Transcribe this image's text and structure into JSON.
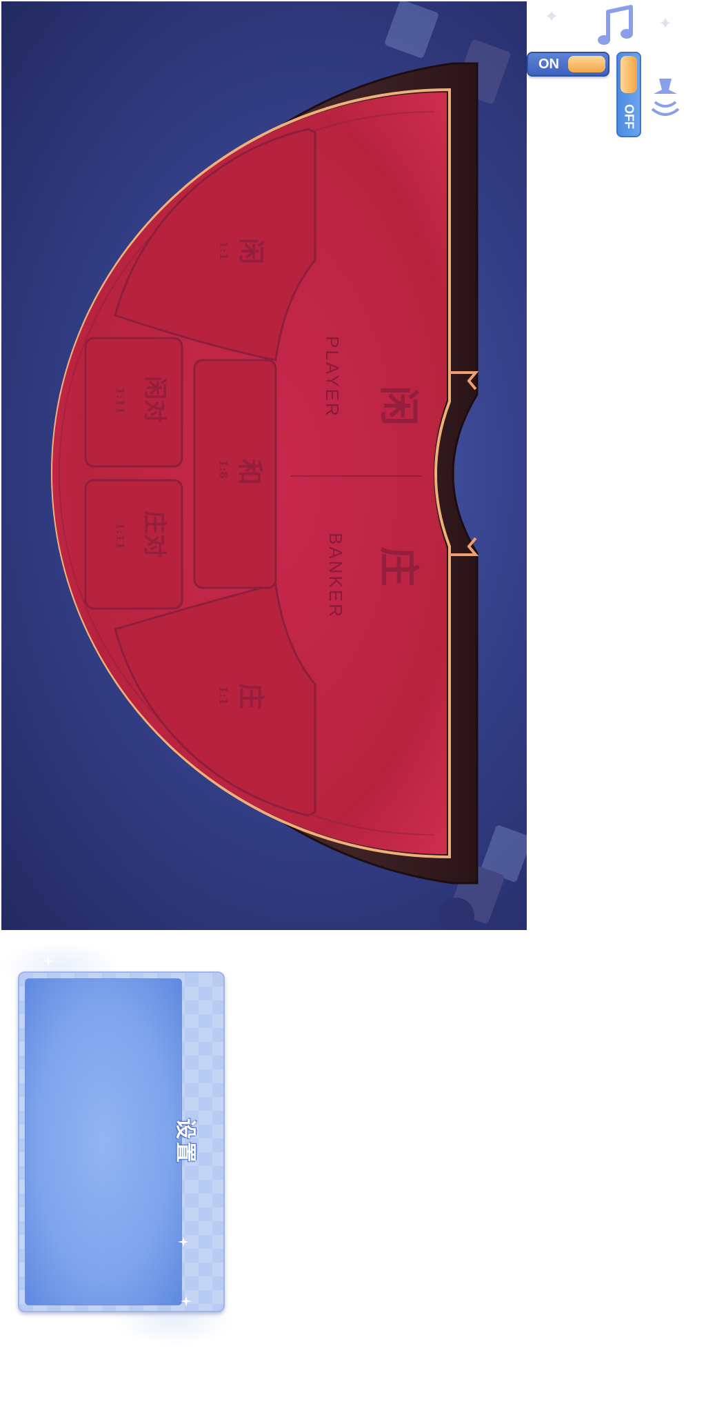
{
  "table": {
    "player_main": "闲",
    "player_main_en": "PLAYER",
    "banker_main": "庄",
    "banker_main_en": "BANKER",
    "zones": [
      {
        "id": "player-bet",
        "label": "闲",
        "odds": "1:1"
      },
      {
        "id": "player-pair",
        "label": "闲对",
        "odds": "1:11"
      },
      {
        "id": "tie",
        "label": "和",
        "odds": "1:8"
      },
      {
        "id": "banker-pair",
        "label": "庄对",
        "odds": "1:11"
      },
      {
        "id": "banker-bet",
        "label": "庄",
        "odds": "1:1"
      }
    ],
    "colors": {
      "felt": "#c9284c",
      "felt_dark": "#a11d3c",
      "rail": "#3a1e22",
      "rim": "#f0b07a",
      "background": "#36418b"
    }
  },
  "controls": {
    "on_label": "ON",
    "off_label": "OFF",
    "music_icon": "music-note-icon",
    "sound_icon": "speaker-icon"
  },
  "dialog": {
    "title": "设置",
    "colors": {
      "frame": "#b7cbf3",
      "panel": "#7ea4ec"
    }
  }
}
